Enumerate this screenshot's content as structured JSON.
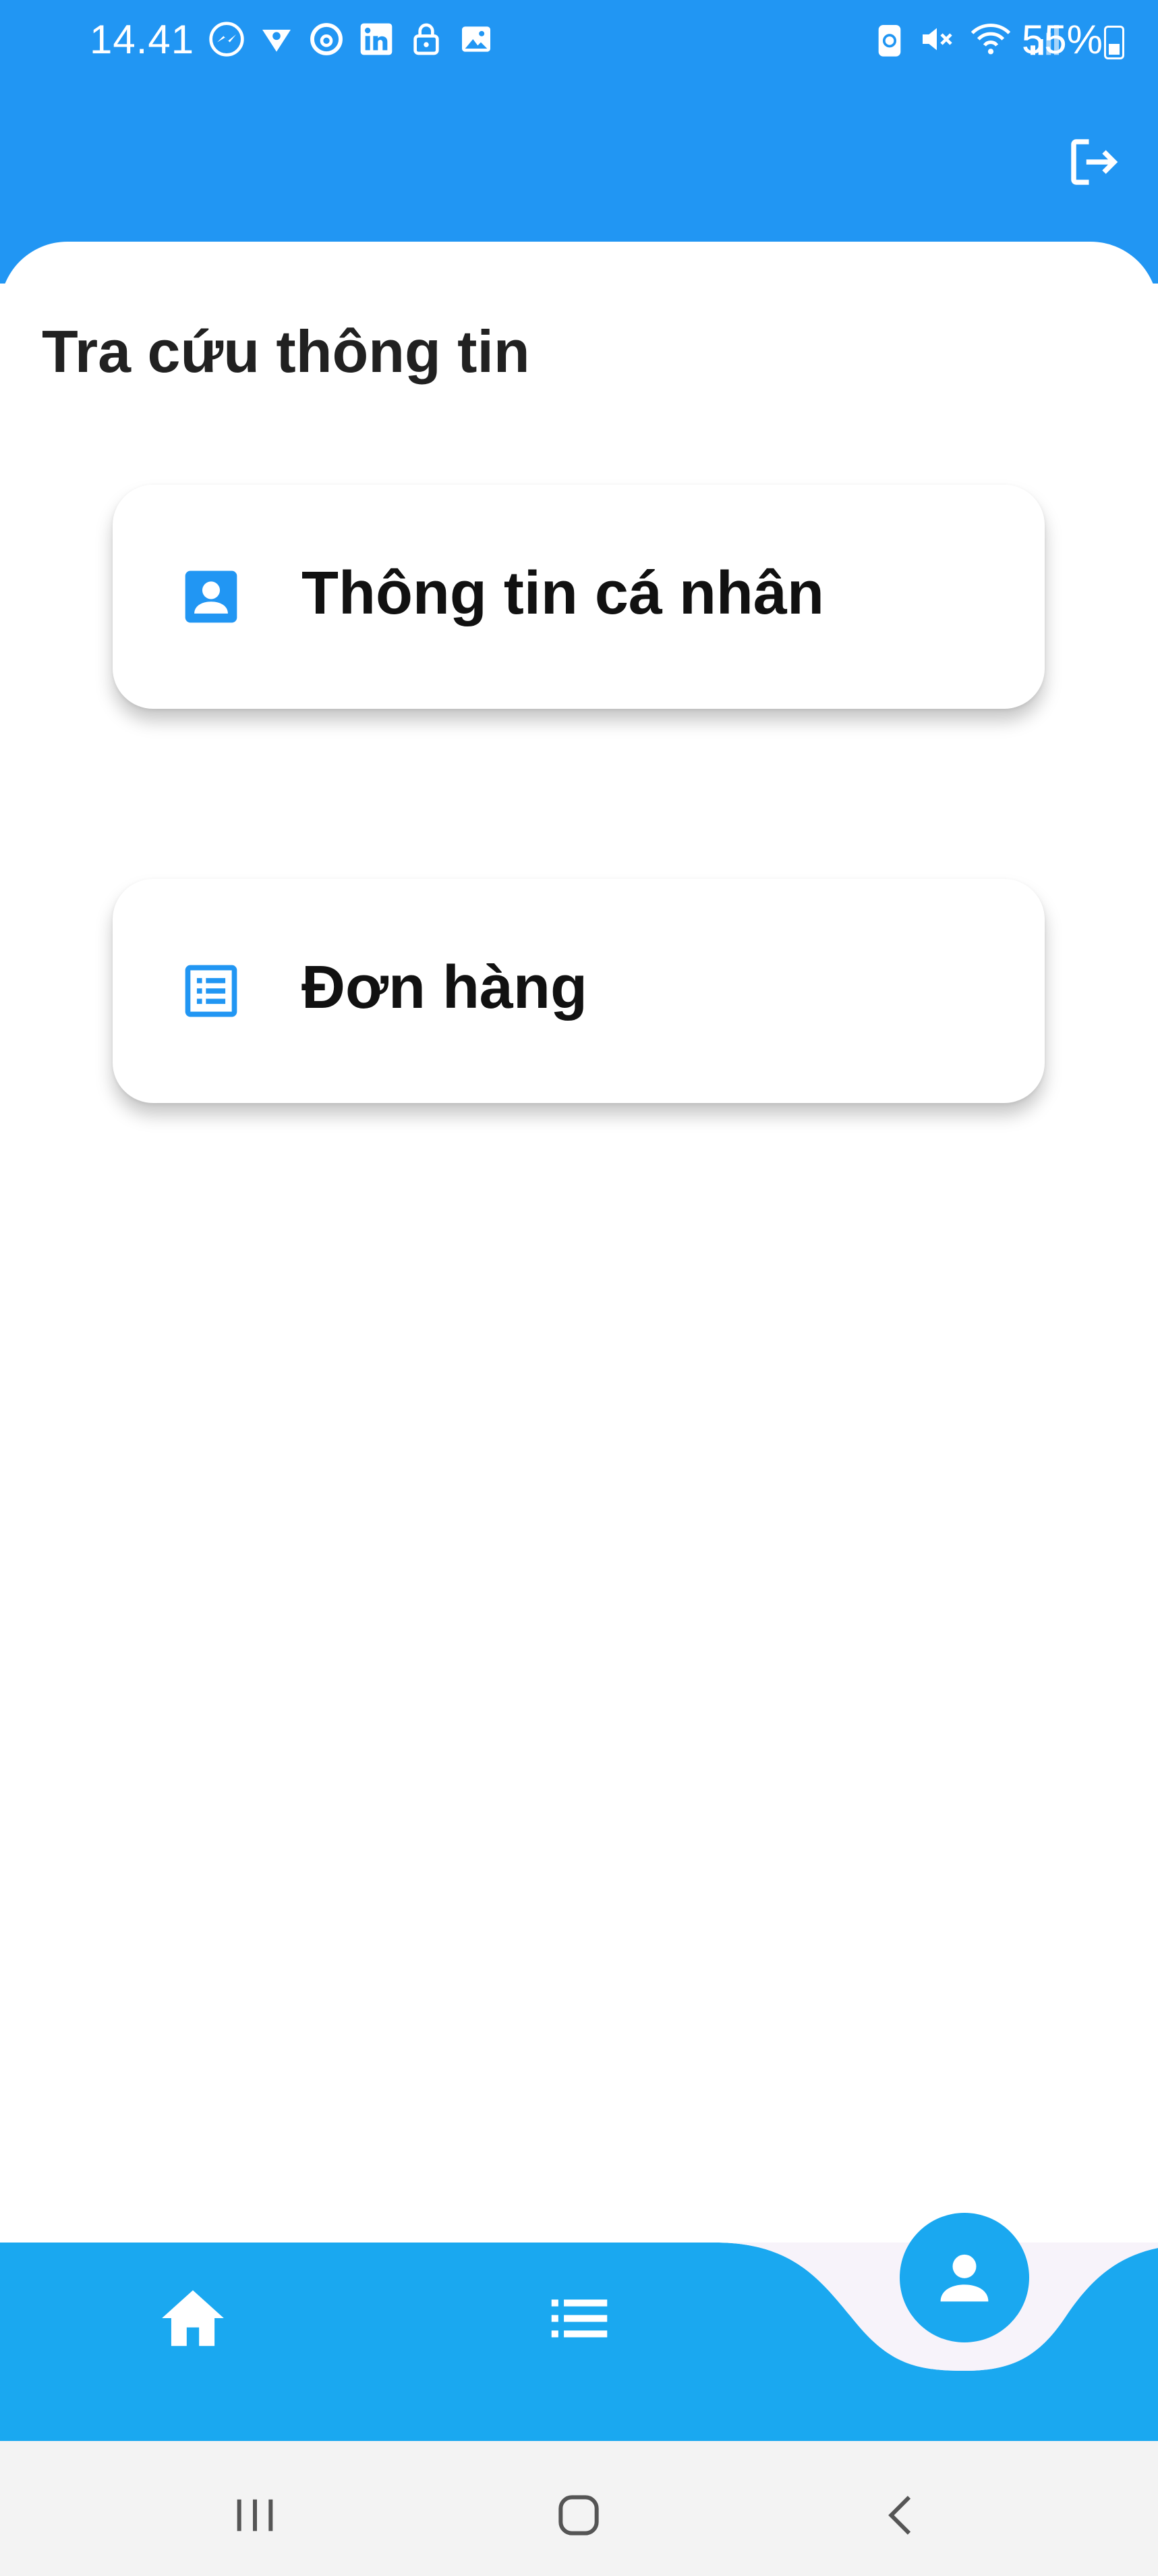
{
  "status_bar": {
    "time": "14.41",
    "battery": "55%",
    "left_icons": [
      "messenger-icon",
      "vpn-icon",
      "threads-icon",
      "linkedin-icon",
      "lock-icon",
      "image-icon"
    ],
    "right_icons": [
      "battery-saver-icon",
      "mute-icon",
      "wifi-icon",
      "signal-icon"
    ]
  },
  "header": {
    "action_icon": "logout-icon"
  },
  "page": {
    "title": "Tra cứu thông tin"
  },
  "menu": {
    "items": [
      {
        "label": "Thông tin cá nhân",
        "icon": "contact-card-icon"
      },
      {
        "label": "Đơn hàng",
        "icon": "list-document-icon"
      }
    ]
  },
  "bottom_nav": {
    "items": [
      "home-icon",
      "list-icon",
      "person-icon"
    ],
    "active": "person-icon"
  },
  "colors": {
    "primary": "#2196F3",
    "nav_bar": "#1AA8F0",
    "text": "#212121"
  }
}
